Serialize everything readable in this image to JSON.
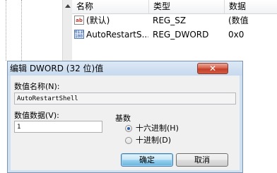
{
  "registry": {
    "columns": {
      "name": "名称",
      "type": "类型",
      "data": "数据"
    },
    "rows": [
      {
        "icon": "string-value-icon",
        "name": "(默认)",
        "type": "REG_SZ",
        "data": "(数值"
      },
      {
        "icon": "binary-value-icon",
        "name": "AutoRestartS...",
        "type": "REG_DWORD",
        "data": "0x0"
      }
    ]
  },
  "dialog": {
    "title": "编辑 DWORD (32 位)值",
    "close_label": "✕",
    "value_name_label": "数值名称(N):",
    "value_name": "AutoRestartShell",
    "value_data_label": "数值数据(V):",
    "value_data": "1",
    "base_label": "基数",
    "base_options": [
      {
        "label": "十六进制(H)",
        "selected": true
      },
      {
        "label": "十进制(D)",
        "selected": false
      }
    ],
    "ok_label": "确定",
    "cancel_label": "取消"
  },
  "colors": {
    "close_button": "#c2402b",
    "dialog_frame": "#cfe0f1",
    "default_button": "#3c7fb1"
  }
}
